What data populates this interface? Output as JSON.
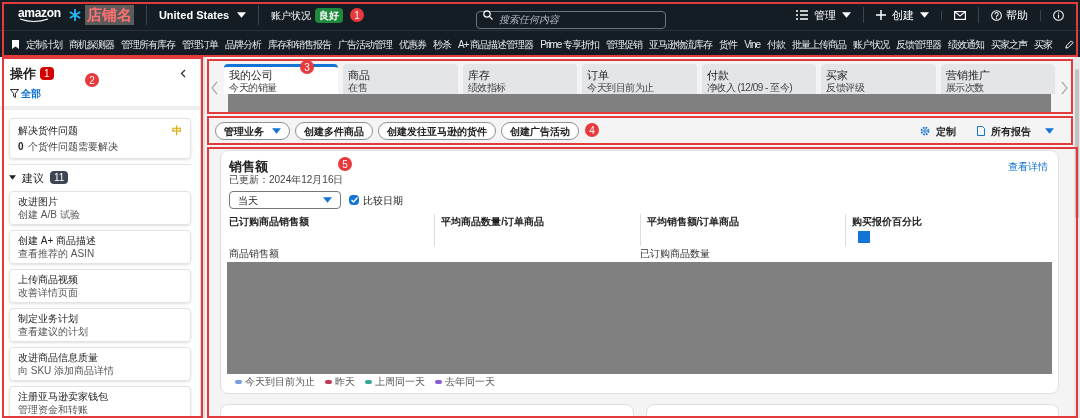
{
  "top_bar": {
    "logo": "amazon",
    "store_name": "店铺名",
    "marketplace": "United States",
    "account_health_label": "账户状况",
    "account_health_badge": "良好",
    "search": {
      "placeholder": "搜索任何内容"
    },
    "actions": [
      {
        "kind": "menu",
        "label": "管理"
      },
      {
        "kind": "create",
        "label": "创建"
      },
      {
        "kind": "mail"
      },
      {
        "kind": "help",
        "label": "帮助"
      },
      {
        "kind": "info"
      }
    ]
  },
  "nav_bar": {
    "items": [
      "定制计划",
      "商机探测器",
      "管理所有库存",
      "管理订单",
      "品牌分析",
      "库存和销售报告",
      "广告活动管理",
      "优惠券",
      "秒杀",
      "A+ 商品描述管理器",
      "Prime 专享折扣",
      "管理促销",
      "亚马逊物流库存",
      "货件",
      "Vine",
      "付款",
      "批量上传商品",
      "账户状况",
      "反馈管理器",
      "绩效通知",
      "买家之声",
      "买家"
    ]
  },
  "sidebar": {
    "title": "操作",
    "count": "1",
    "filter": "全部",
    "task": {
      "title": "解决货件问题",
      "priority": "中",
      "count": "0",
      "text": "个货件问题需要解决"
    },
    "section": {
      "title": "建议",
      "count": "11",
      "expanded": true
    },
    "items": [
      {
        "title": "改进图片",
        "subtitle": "创建 A/B 试验"
      },
      {
        "title": "创建 A+ 商品描述",
        "subtitle": "查看推荐的 ASIN"
      },
      {
        "title": "上传商品视频",
        "subtitle": "改善详情页面"
      },
      {
        "title": "制定业务计划",
        "subtitle": "查看建议的计划"
      },
      {
        "title": "改进商品信息质量",
        "subtitle": "向 SKU 添加商品详情"
      },
      {
        "title": "注册亚马逊卖家钱包",
        "subtitle": "管理资金和转账"
      }
    ]
  },
  "tabs": [
    {
      "label": "我的公司",
      "subtitle": "今天的销量",
      "selected": true
    },
    {
      "label": "商品",
      "subtitle": "在售",
      "selected": false
    },
    {
      "label": "库存",
      "subtitle": "绩效指标",
      "selected": false
    },
    {
      "label": "订单",
      "subtitle": "今天到目前为止",
      "selected": false
    },
    {
      "label": "付款",
      "subtitle": "净收入 (12/09 - 至今)",
      "selected": false
    },
    {
      "label": "买家",
      "subtitle": "反馈评级",
      "selected": false
    },
    {
      "label": "营销推广",
      "subtitle": "展示次数",
      "selected": false
    }
  ],
  "action_bar": {
    "buttons": [
      {
        "label": "管理业务",
        "dropdown": true
      },
      {
        "label": "创建多件商品",
        "dropdown": false
      },
      {
        "label": "创建发往亚马逊的货件",
        "dropdown": false
      },
      {
        "label": "创建广告活动",
        "dropdown": false
      }
    ],
    "customize": "定制",
    "reports": "所有报告"
  },
  "sales_card": {
    "title": "销售额",
    "updated": "已更新：2024年12月16日",
    "link": "查看详情",
    "period": "当天",
    "compare_dates": {
      "label": "比较日期",
      "checked": true
    },
    "metrics": [
      "已订购商品销售额",
      "平均商品数量/订单商品",
      "平均销售额/订单商品",
      "购买报价百分比"
    ],
    "chart_labels": [
      "商品销售额",
      "已订购商品数量"
    ],
    "legend": [
      {
        "label": "今天到目前为止",
        "color": "#7b9be0"
      },
      {
        "label": "昨天",
        "color": "#c0395a"
      },
      {
        "label": "上周同一天",
        "color": "#3aa896"
      },
      {
        "label": "去年同一天",
        "color": "#8a5cd6"
      }
    ]
  },
  "annotations": [
    "1",
    "2",
    "3",
    "4",
    "5"
  ]
}
